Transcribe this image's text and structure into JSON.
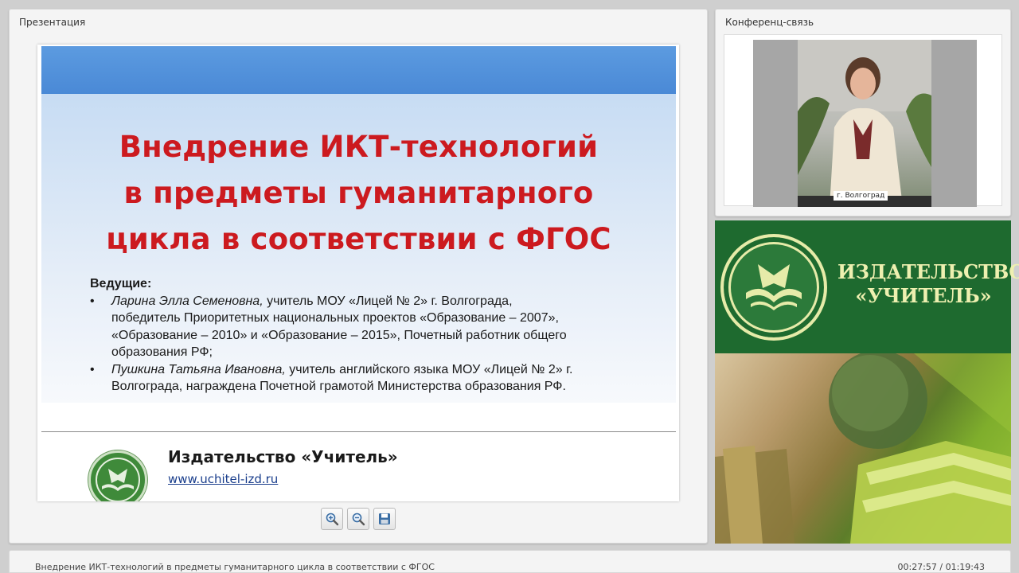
{
  "presentation_panel": {
    "title": "Презентация"
  },
  "conference_panel": {
    "title": "Конференц-связь",
    "video_caption": "г. Волгоград"
  },
  "slide": {
    "title_lines": [
      "Внедрение ИКТ-технологий",
      "в предметы гуманитарного",
      "цикла в соответствии с ФГОС"
    ],
    "hosts_label": "Ведущие:",
    "bullet": "•",
    "hosts": [
      {
        "name": "Ларина Элла Семеновна,",
        "lines": [
          " учитель МОУ «Лицей № 2» г. Волгограда,",
          "победитель Приоритетных национальных проектов «Образование – 2007»,",
          "«Образование – 2010» и «Образование – 2015», Почетный работник общего",
          "образования РФ;"
        ]
      },
      {
        "name": "Пушкина Татьяна Ивановна,",
        "lines": [
          " учитель английского языка МОУ «Лицей № 2» г.",
          "Волгограда, награждена Почетной грамотой Министерства образования РФ."
        ]
      }
    ],
    "publisher": "Издательство «Учитель»",
    "url": "www.uchitel-izd.ru"
  },
  "toolbar": {
    "zoom_in_icon": "zoom-in-icon",
    "zoom_out_icon": "zoom-out-icon",
    "save_icon": "floppy-disk-icon"
  },
  "ad": {
    "line1": "ИЗДАТЕЛЬСТВО",
    "line2": "«УЧИТЕЛЬ»",
    "colors": {
      "green": "#1e6a2f",
      "cream": "#eef0b0"
    }
  },
  "status": {
    "title": "Внедрение ИКТ-технологий в предметы гуманитарного цикла в соответствии с ФГОС",
    "time": "00:27:57 / 01:19:43"
  },
  "colors": {
    "slide_title": "#cc1a1f",
    "slide_band": "#4a89d6",
    "link": "#1a3e8c"
  }
}
